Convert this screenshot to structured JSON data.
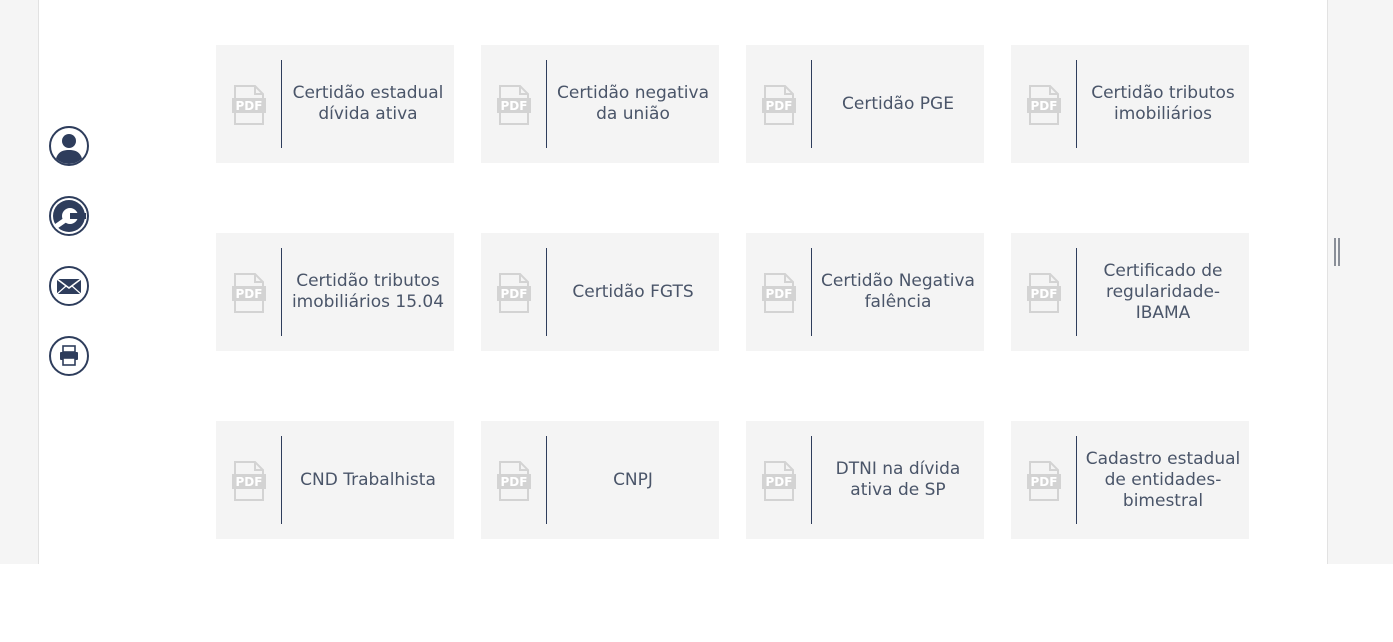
{
  "colors": {
    "navy": "#2e3d5c",
    "card_bg": "#f4f4f4",
    "text": "#4a5569",
    "pdf_icon": "#d3d3d3"
  },
  "sidebar": {
    "buttons": [
      {
        "name": "user-icon",
        "label": "user"
      },
      {
        "name": "wrench-icon",
        "label": "tools"
      },
      {
        "name": "mail-icon",
        "label": "email"
      },
      {
        "name": "print-icon",
        "label": "print"
      }
    ]
  },
  "pdf_icon_text": "PDF",
  "documents": [
    {
      "label": "Certidão estadual dívida ativa"
    },
    {
      "label": "Certidão negativa da união"
    },
    {
      "label": "Certidão PGE"
    },
    {
      "label": "Certidão tributos imobiliários"
    },
    {
      "label": "Certidão tributos imobiliários 15.04"
    },
    {
      "label": "Certidão FGTS"
    },
    {
      "label": "Certidão Negativa falência"
    },
    {
      "label": "Certificado de regularidade-IBAMA"
    },
    {
      "label": "CND Trabalhista"
    },
    {
      "label": "CNPJ"
    },
    {
      "label": "DTNI na dívida ativa de SP"
    },
    {
      "label": "Cadastro estadual de entidades-bimestral"
    }
  ]
}
